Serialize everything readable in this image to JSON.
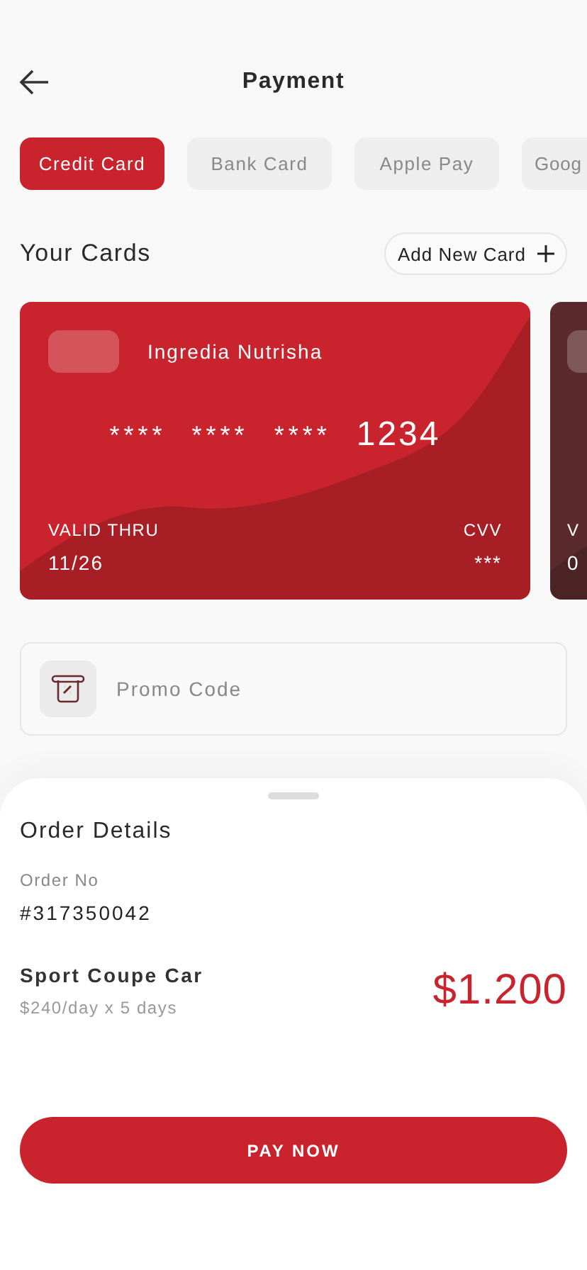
{
  "header": {
    "title": "Payment"
  },
  "tabs": [
    {
      "label": "Credit Card",
      "selected": true
    },
    {
      "label": "Bank Card",
      "selected": false
    },
    {
      "label": "Apple Pay",
      "selected": false
    },
    {
      "label": "Goog",
      "selected": false
    }
  ],
  "cards_section": {
    "title": "Your Cards",
    "add_button": "Add New Card"
  },
  "cards": [
    {
      "color": "#c9242d",
      "holder": "Ingredia Nutrisha",
      "number_groups": [
        "****",
        "****",
        "****",
        "1234"
      ],
      "valid_label": "VALID THRU",
      "valid": "11/26",
      "cvv_label": "CVV",
      "cvv": "***"
    },
    {
      "color": "#5b2a2d",
      "valid_label": "V",
      "valid": "0"
    }
  ],
  "promo": {
    "placeholder": "Promo Code"
  },
  "order": {
    "title": "Order Details",
    "order_no_label": "Order No",
    "order_no": "#317350042",
    "item": "Sport Coupe Car",
    "rate": "$240/day x 5 days",
    "total": "$1.200"
  },
  "pay_button": "PAY NOW"
}
